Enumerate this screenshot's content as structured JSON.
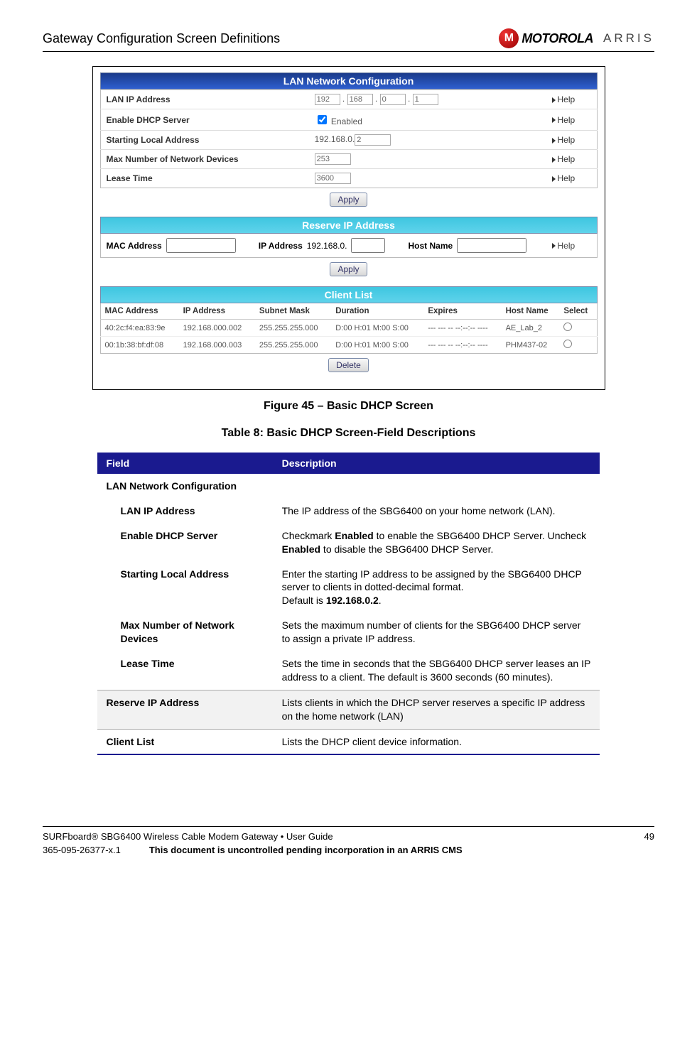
{
  "header": {
    "title": "Gateway Configuration Screen Definitions",
    "brand1": "MOTOROLA",
    "brand2": "ARRIS"
  },
  "screenshot": {
    "lan": {
      "title": "LAN Network Configuration",
      "rows": {
        "ip_label": "LAN IP Address",
        "ip_o1": "192",
        "ip_o2": "168",
        "ip_o3": "0",
        "ip_o4": "1",
        "dhcp_label": "Enable DHCP Server",
        "dhcp_value": "Enabled",
        "start_label": "Starting Local Address",
        "start_prefix": "192.168.0.",
        "start_val": "2",
        "max_label": "Max Number of Network Devices",
        "max_val": "253",
        "lease_label": "Lease Time",
        "lease_val": "3600"
      },
      "help": "Help",
      "apply": "Apply"
    },
    "reserve": {
      "title": "Reserve IP Address",
      "mac_label": "MAC Address",
      "ip_label": "IP Address",
      "ip_prefix": "192.168.0.",
      "host_label": "Host Name",
      "help": "Help",
      "apply": "Apply"
    },
    "clients": {
      "title": "Client List",
      "cols": {
        "mac": "MAC Address",
        "ip": "IP Address",
        "mask": "Subnet Mask",
        "dur": "Duration",
        "exp": "Expires",
        "host": "Host Name",
        "sel": "Select"
      },
      "rows": [
        {
          "mac": "40:2c:f4:ea:83:9e",
          "ip": "192.168.000.002",
          "mask": "255.255.255.000",
          "dur": "D:00 H:01 M:00 S:00",
          "exp": "--- --- -- --:--:-- ----",
          "host": "AE_Lab_2"
        },
        {
          "mac": "00:1b:38:bf:df:08",
          "ip": "192.168.000.003",
          "mask": "255.255.255.000",
          "dur": "D:00 H:01 M:00 S:00",
          "exp": "--- --- -- --:--:-- ----",
          "host": "PHM437-02"
        }
      ],
      "delete": "Delete"
    }
  },
  "figure_caption": "Figure 45 – Basic DHCP Screen",
  "table_caption": "Table 8: Basic DHCP Screen-Field Descriptions",
  "desc_table": {
    "header_field": "Field",
    "header_desc": "Description",
    "section_lan": "LAN Network Configuration",
    "rows": [
      {
        "f": "LAN IP Address",
        "d": "The IP address of the SBG6400 on your home network (LAN)."
      },
      {
        "f": "Enable DHCP Server",
        "d": "Checkmark <b>Enabled</b> to enable the SBG6400 DHCP Server. Uncheck <b>Enabled</b> to disable the SBG6400 DHCP Server."
      },
      {
        "f": "Starting Local Address",
        "d": "Enter the starting IP address to be assigned by the SBG6400 DHCP server to clients in dotted-decimal format. Default is <b>192.168.0.2</b>."
      },
      {
        "f": "Max Number of Network Devices",
        "d": "Sets the maximum number of clients for the SBG6400 DHCP server to assign a private IP address."
      },
      {
        "f": "Lease Time",
        "d": "Sets the time in seconds that the SBG6400 DHCP server leases an IP address to a client. The default is 3600 seconds (60 minutes)."
      }
    ],
    "reserve_label": "Reserve IP Address",
    "reserve_desc": "Lists clients in which the DHCP server reserves a specific IP address on the home network (LAN)",
    "client_label": "Client List",
    "client_desc": "Lists the DHCP client device information."
  },
  "footer": {
    "product": "SURFboard® SBG6400 Wireless Cable Modem Gateway • User Guide",
    "page": "49",
    "docnum": "365-095-26377-x.1",
    "notice": "This document is uncontrolled pending incorporation in an ARRIS CMS"
  }
}
